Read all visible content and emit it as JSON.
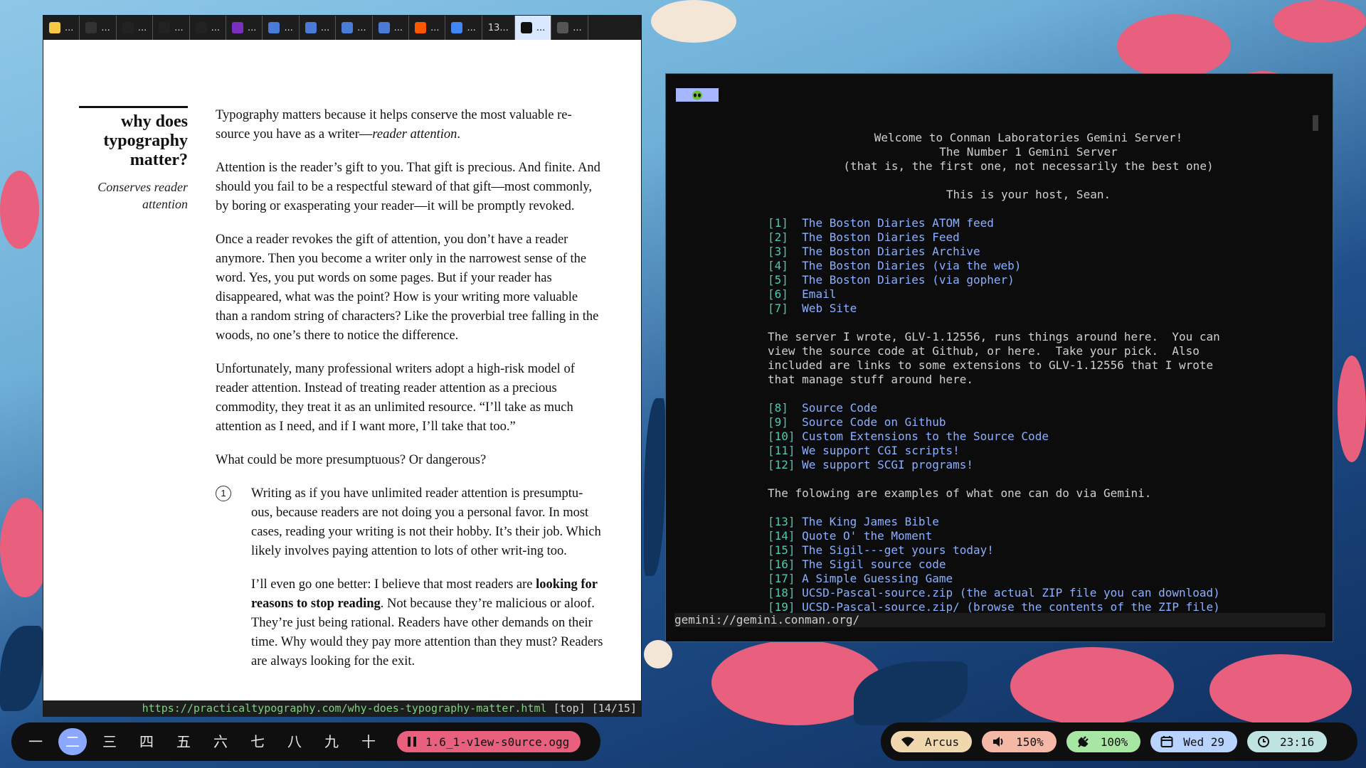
{
  "browser": {
    "tabs": [
      {
        "icon": "emoji-face-icon",
        "label": "...",
        "color": "#f6c945"
      },
      {
        "icon": "notion-icon",
        "label": "...",
        "color": "#333333"
      },
      {
        "icon": "github-icon",
        "label": "...",
        "color": "#222222"
      },
      {
        "icon": "github-icon",
        "label": "...",
        "color": "#222222"
      },
      {
        "icon": "github-icon",
        "label": "...",
        "color": "#222222"
      },
      {
        "icon": "onenote-icon",
        "label": "...",
        "color": "#7b2fbe"
      },
      {
        "icon": "google-docs-icon",
        "label": "...",
        "color": "#4a7bd6"
      },
      {
        "icon": "google-docs-icon",
        "label": "...",
        "color": "#4a7bd6"
      },
      {
        "icon": "google-docs-icon",
        "label": "...",
        "color": "#4a7bd6"
      },
      {
        "icon": "google-docs-icon",
        "label": "...",
        "color": "#4a7bd6"
      },
      {
        "icon": "reddit-icon",
        "label": "...",
        "color": "#ff5700"
      },
      {
        "icon": "google-icon",
        "label": "...",
        "color": "#4285f4"
      },
      {
        "icon": "",
        "label": "13..."
      },
      {
        "icon": "pt-icon",
        "label": "...",
        "color": "#111111",
        "active": true
      },
      {
        "icon": "generic-icon",
        "label": "...",
        "color": "#555555"
      }
    ],
    "sidenote": {
      "heading": "why does typography matter?",
      "subheading": "Conserves reader attention"
    },
    "paragraphs": [
      {
        "main": "Typography matters because it helps conserve the most valuable re-source you have as a writer—",
        "em": "reader attention",
        "tail": "."
      },
      {
        "main": "Attention is the reader’s gift to you. That gift is precious. And finite. And should you fail to be a respectful steward of that gift—most commonly, by boring or exasperating your reader—it will be promptly revoked."
      },
      {
        "main": "Once a reader revokes the gift of attention, you don’t have a reader anymore. Then you become a writer only in the narrowest sense of the word. Yes, you put words on some pages. But if your reader has disappeared, what was the point? How is your writing more valuable than a random string of characters? Like the proverbial tree falling in the woods, no one’s there to notice the difference."
      },
      {
        "main": "Unfortunately, many professional writers adopt a high-risk model of reader attention. Instead of treating reader attention as a precious commodity, they treat it as an unlimited resource. “I’ll take as much attention as I need, and if I want more, I’ll take that too.”"
      },
      {
        "main": "What could be more presumptuous? Or dangerous?"
      }
    ],
    "list_item": {
      "number": "1",
      "p1": "Writing as if you have unlimited reader attention is presumptu-ous, because readers are not doing you a personal favor. In most cases, reading your writing is not their hobby. It’s their job. Which likely involves paying attention to lots of other writ-ing too.",
      "p2_before": "I’ll even go one better: I believe that most readers are ",
      "p2_bold": "looking for reasons to stop reading",
      "p2_after": ". Not because they’re malicious or aloof. They’re just being rational. Readers have other demands on their time. Why would they pay more attention than they must? Readers are always looking for the exit."
    },
    "status": {
      "url": "https://practicaltypography.com/why-does-typography-matter.html",
      "position": "[top] [14/15]"
    }
  },
  "terminal": {
    "tab_icon": "alien-icon",
    "header": [
      "Welcome to Conman Laboratories Gemini Server!",
      "The Number 1 Gemini Server",
      "(that is, the first one, not necessarily the best one)",
      "",
      "This is your host, Sean."
    ],
    "links1": [
      {
        "key": "[1]",
        "text": "The Boston Diaries ATOM feed"
      },
      {
        "key": "[2]",
        "text": "The Boston Diaries Feed"
      },
      {
        "key": "[3]",
        "text": "The Boston Diaries Archive"
      },
      {
        "key": "[4]",
        "text": "The Boston Diaries (via the web)"
      },
      {
        "key": "[5]",
        "text": "The Boston Diaries (via gopher)"
      },
      {
        "key": "[6]",
        "text": "Email"
      },
      {
        "key": "[7]",
        "text": "Web Site"
      }
    ],
    "paragraph": [
      "The server I wrote, GLV-1.12556, runs things around here.  You can",
      "view the source code at Github, or here.  Take your pick.  Also",
      "included are links to some extensions to GLV-1.12556 that I wrote",
      "that manage stuff around here."
    ],
    "links2": [
      {
        "key": "[8]",
        "text": "Source Code"
      },
      {
        "key": "[9]",
        "text": "Source Code on Github"
      },
      {
        "key": "[10]",
        "text": "Custom Extensions to the Source Code"
      },
      {
        "key": "[11]",
        "text": "We support CGI scripts!"
      },
      {
        "key": "[12]",
        "text": "We support SCGI programs!"
      }
    ],
    "examples_intro": "The folowing are examples of what one can do via Gemini.",
    "links3": [
      {
        "key": "[13]",
        "text": "The King James Bible"
      },
      {
        "key": "[14]",
        "text": "Quote O' the Moment"
      },
      {
        "key": "[15]",
        "text": "The Sigil---get yours today!"
      },
      {
        "key": "[16]",
        "text": "The Sigil source code"
      },
      {
        "key": "[17]",
        "text": "A Simple Guessing Game"
      },
      {
        "key": "[18]",
        "text": "UCSD-Pascal-source.zip (the actual ZIP file you can download)"
      },
      {
        "key": "[19]",
        "text": "UCSD-Pascal-source.zip/ (browse the contents of the ZIP file)"
      }
    ],
    "url_bar": "gemini://gemini.conman.org/"
  },
  "taskbar_left": {
    "workspaces": [
      "一",
      "二",
      "三",
      "四",
      "五",
      "六",
      "七",
      "八",
      "九",
      "十"
    ],
    "active_index": 1,
    "media": {
      "icon": "pause-icon",
      "track": "1.6_1-v1ew-s0urce.ogg"
    }
  },
  "taskbar_right": {
    "wifi": {
      "label": "Arcus",
      "color": "#f0d7ad"
    },
    "volume": {
      "label": "150%",
      "color": "#f5b8a6"
    },
    "battery": {
      "label": "100%",
      "color": "#a8e6a3"
    },
    "date": {
      "label": "Wed 29",
      "color": "#b9d3ff"
    },
    "clock": {
      "label": "23:16",
      "color": "#bfe3e0"
    }
  }
}
